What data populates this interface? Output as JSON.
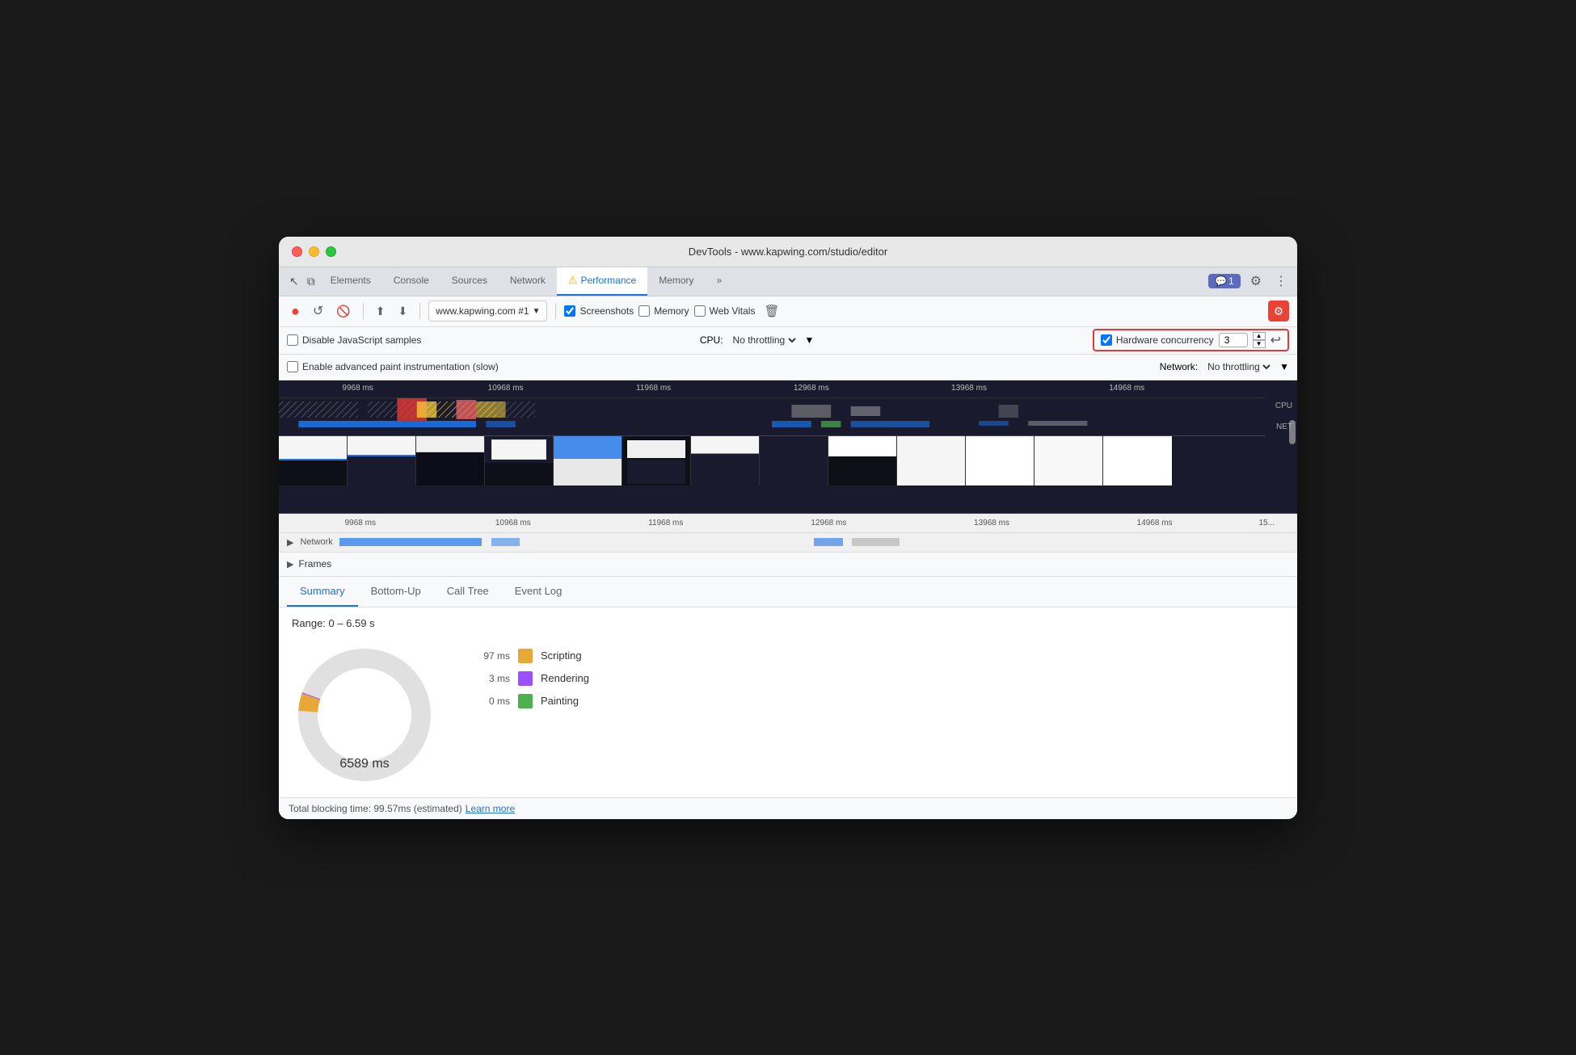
{
  "window": {
    "title": "DevTools - www.kapwing.com/studio/editor"
  },
  "nav": {
    "tabs": [
      {
        "label": "Elements",
        "active": false
      },
      {
        "label": "Console",
        "active": false
      },
      {
        "label": "Sources",
        "active": false
      },
      {
        "label": "Network",
        "active": false
      },
      {
        "label": "Performance",
        "active": true,
        "icon": "warning"
      },
      {
        "label": "Memory",
        "active": false
      },
      {
        "label": "»",
        "active": false
      }
    ],
    "notification_count": "1",
    "nav_icon_cursor": "↖",
    "nav_icon_layers": "⧉"
  },
  "toolbar": {
    "record_btn": "●",
    "reload_btn": "↺",
    "clear_btn": "🚫",
    "upload_btn": "⬆",
    "download_btn": "⬇",
    "url_value": "www.kapwing.com #1",
    "screenshots_label": "Screenshots",
    "screenshots_checked": true,
    "memory_label": "Memory",
    "memory_checked": false,
    "webvitals_label": "Web Vitals",
    "webvitals_checked": false,
    "trash_label": "🗑",
    "settings_icon": "⚙"
  },
  "options": {
    "disable_js_label": "Disable JavaScript samples",
    "disable_js_checked": false,
    "cpu_label": "CPU:",
    "cpu_throttle": "No throttling",
    "hardware_concurrency_label": "Hardware concurrency",
    "hardware_concurrency_checked": true,
    "hardware_concurrency_value": "3",
    "undo_label": "↩"
  },
  "options2": {
    "advanced_paint_label": "Enable advanced paint instrumentation (slow)",
    "advanced_paint_checked": false,
    "network_label": "Network:",
    "network_throttle": "No throttling"
  },
  "timeline": {
    "ruler_labels": [
      "9968 ms",
      "10968 ms",
      "11968 ms",
      "12968 ms",
      "13968 ms",
      "14968 ms"
    ],
    "ruler_positions": [
      8,
      22,
      38,
      54,
      70,
      86
    ],
    "bottom_labels": [
      "9968 ms",
      "10968 ms",
      "11968 ms",
      "12968 ms",
      "13968 ms",
      "14968 ms",
      "15..."
    ],
    "bottom_positions": [
      8,
      22,
      38,
      54,
      70,
      86,
      97
    ],
    "cpu_label": "CPU",
    "net_label": "NET"
  },
  "bottom": {
    "network_label": "▶ Network",
    "frames_label": "▶ Frames"
  },
  "analysis_tabs": {
    "tabs": [
      "Summary",
      "Bottom-Up",
      "Call Tree",
      "Event Log"
    ],
    "active_tab": "Summary"
  },
  "summary": {
    "range_text": "Range: 0 – 6.59 s",
    "pie_center": "6589 ms",
    "legend_items": [
      {
        "value": "97 ms",
        "color": "#e8a838",
        "label": "Scripting"
      },
      {
        "value": "3 ms",
        "color": "#9c4fff",
        "label": "Rendering"
      },
      {
        "value": "0 ms",
        "color": "#4caf50",
        "label": "Painting"
      }
    ]
  },
  "status_bar": {
    "text": "Total blocking time: 99.57ms (estimated)",
    "learn_more": "Learn more"
  },
  "colors": {
    "active_tab_blue": "#1a73e8",
    "warning_yellow": "#f9a825",
    "record_red": "#ea4335",
    "scripting_yellow": "#e8a838",
    "rendering_purple": "#9c4fff",
    "painting_green": "#4caf50"
  }
}
